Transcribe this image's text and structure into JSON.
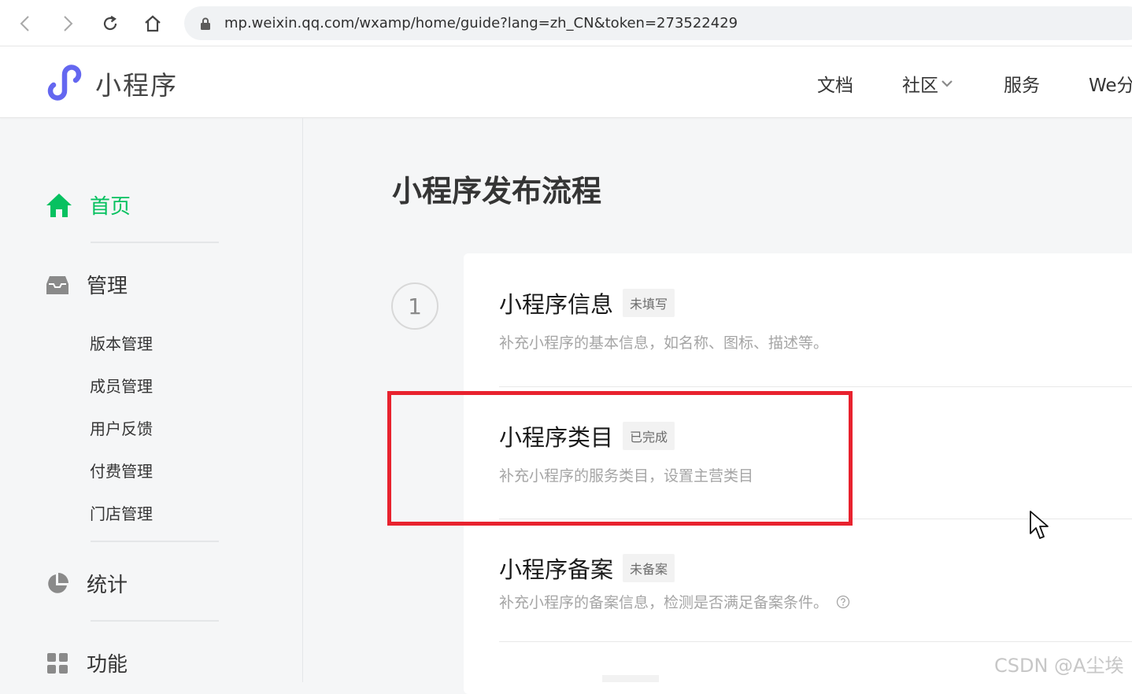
{
  "browser": {
    "url": "mp.weixin.qq.com/wxamp/home/guide?lang=zh_CN&token=273522429"
  },
  "header": {
    "brand": "小程序",
    "nav": [
      {
        "label": "文档"
      },
      {
        "label": "社区"
      },
      {
        "label": "服务"
      },
      {
        "label": "We分"
      }
    ]
  },
  "sidebar": {
    "home": "首页",
    "manage": "管理",
    "manage_items": [
      "版本管理",
      "成员管理",
      "用户反馈",
      "付费管理",
      "门店管理"
    ],
    "stats": "统计",
    "features": "功能"
  },
  "main": {
    "title": "小程序发布流程",
    "step_number": "1",
    "steps": [
      {
        "title": "小程序信息",
        "status": "未填写",
        "desc": "补充小程序的基本信息，如名称、图标、描述等。"
      },
      {
        "title": "小程序类目",
        "status": "已完成",
        "desc": "补充小程序的服务类目，设置主营类目"
      },
      {
        "title": "小程序备案",
        "status": "未备案",
        "desc": "补充小程序的备案信息，检测是否满足备案条件。"
      }
    ]
  },
  "watermark": "CSDN @A尘埃",
  "colors": {
    "accent_green": "#07c160",
    "brand_purple": "#6467f0",
    "highlight_red": "#e8222e"
  }
}
